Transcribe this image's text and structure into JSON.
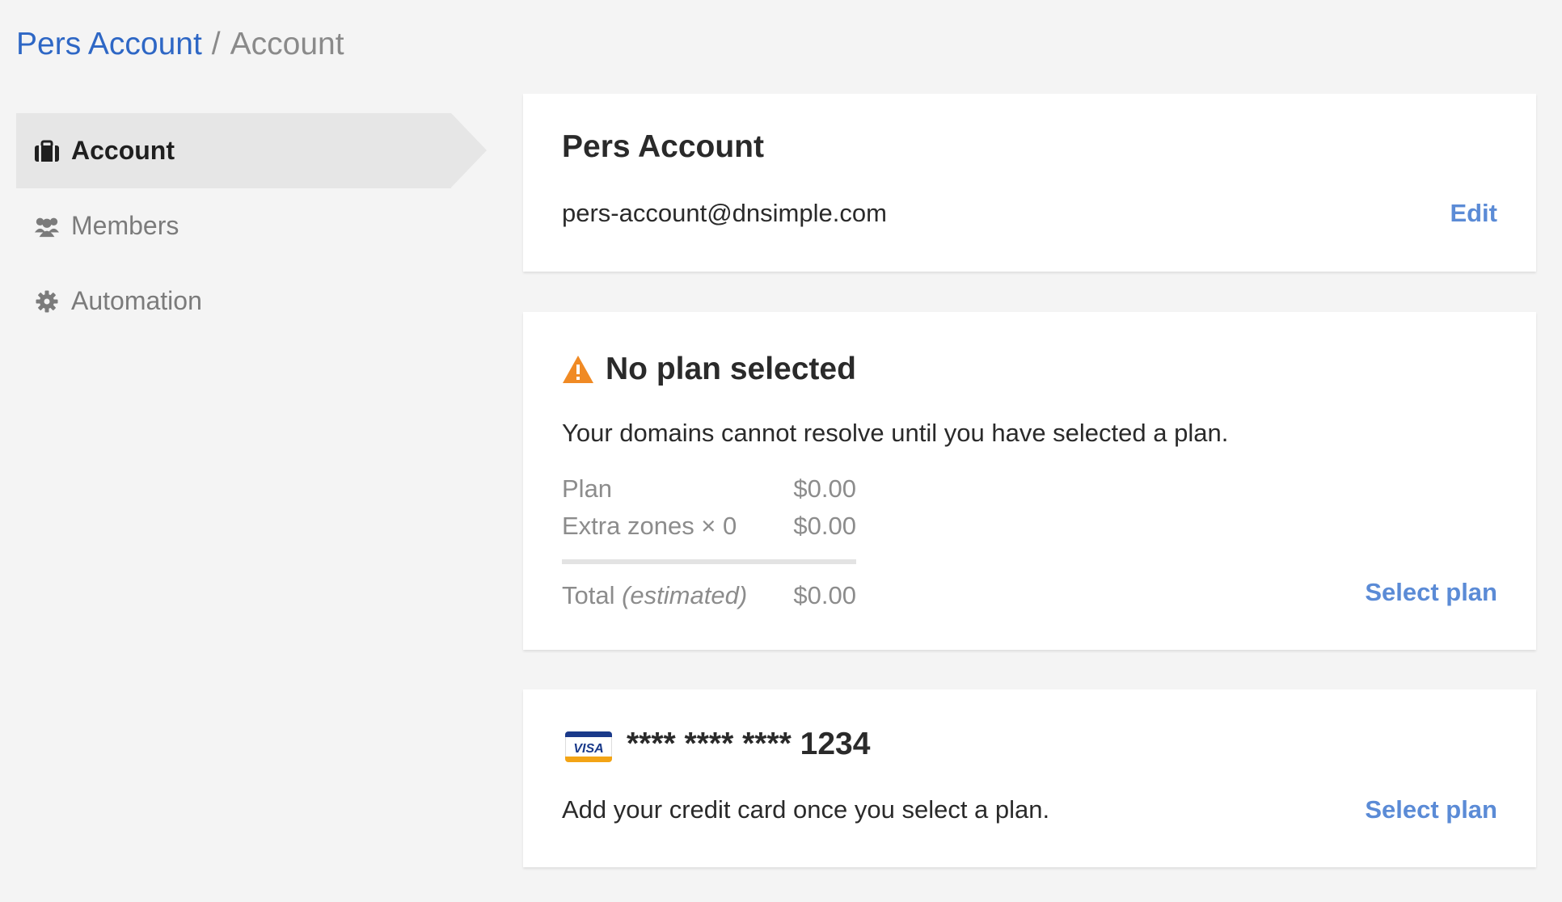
{
  "breadcrumb": {
    "parent": "Pers Account",
    "separator": "/",
    "current": "Account"
  },
  "sidebar": {
    "items": [
      {
        "label": "Account",
        "icon": "briefcase-icon",
        "active": true
      },
      {
        "label": "Members",
        "icon": "users-icon",
        "active": false
      },
      {
        "label": "Automation",
        "icon": "gear-icon",
        "active": false
      }
    ]
  },
  "account_card": {
    "title": "Pers Account",
    "email": "pers-account@dnsimple.com",
    "edit_label": "Edit"
  },
  "plan_card": {
    "warning_icon": "warning-icon",
    "title": "No plan selected",
    "message": "Your domains cannot resolve until you have selected a plan.",
    "rows": [
      {
        "label": "Plan",
        "value": "$0.00"
      },
      {
        "label": "Extra zones × 0",
        "value": "$0.00"
      }
    ],
    "total_label": "Total",
    "total_note": "(estimated)",
    "total_value": "$0.00",
    "select_label": "Select plan"
  },
  "card_card": {
    "card_brand": "VISA",
    "card_number": "**** **** ****",
    "card_last4": "1234",
    "message": "Add your credit card once you select a plan.",
    "select_label": "Select plan"
  },
  "colors": {
    "link": "#2e67c5",
    "action": "#5b8bd6",
    "warning": "#f08a24",
    "background": "#f4f4f4"
  }
}
